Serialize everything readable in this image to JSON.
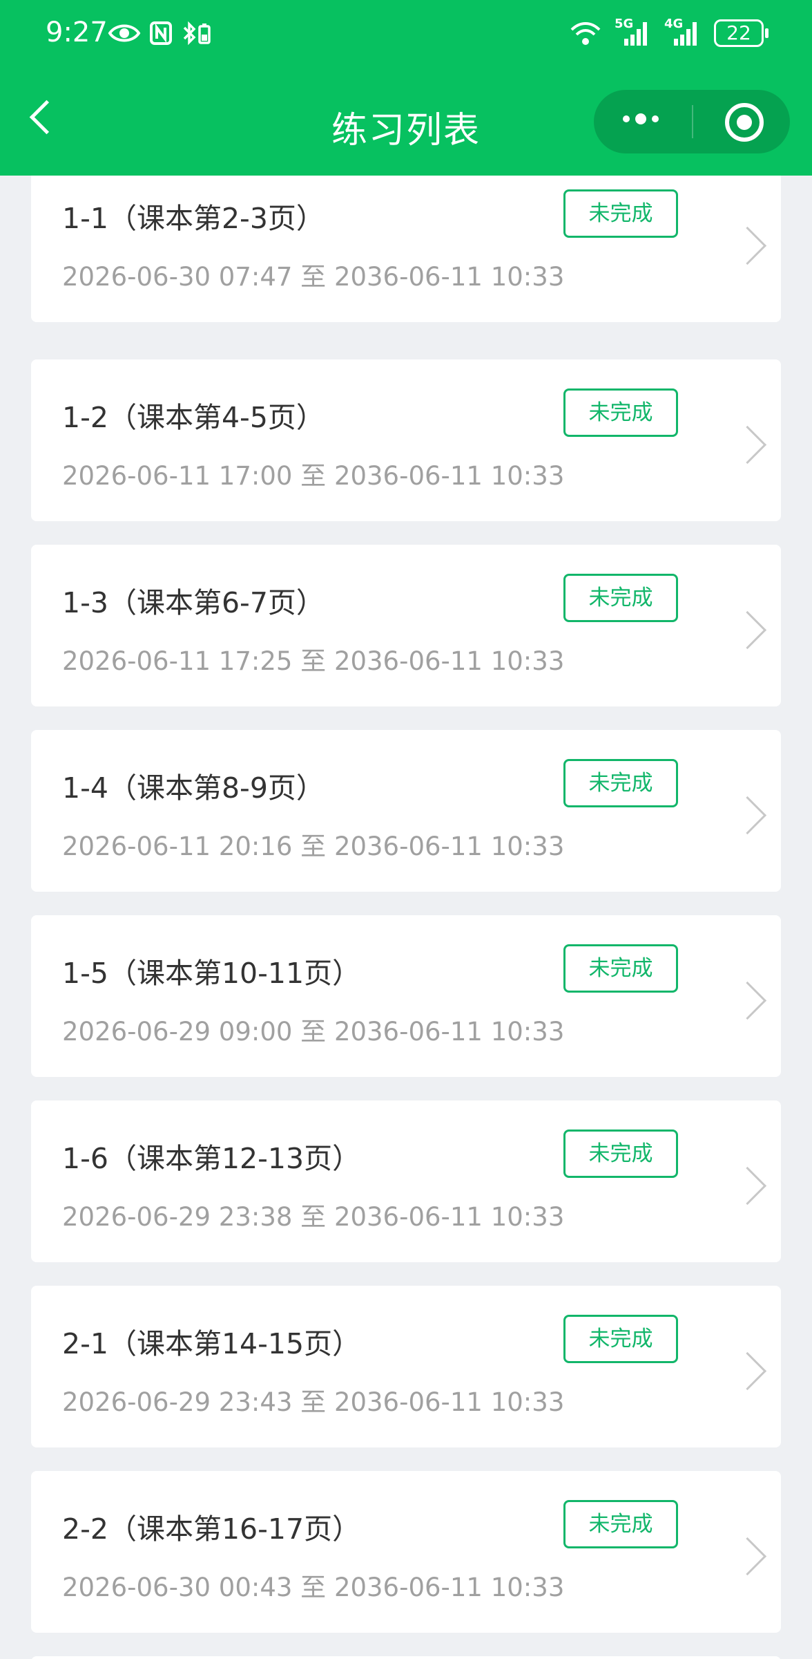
{
  "status_bar": {
    "time": "9:27",
    "icons_left": [
      "eye-icon",
      "nfc-icon",
      "bluetooth-battery-icon"
    ],
    "icons_right": [
      "wifi-icon",
      "signal-5g-icon",
      "signal-4g-icon"
    ],
    "network_5g": "5G",
    "network_4g": "4G",
    "battery": "22"
  },
  "navbar": {
    "title": "练习列表",
    "back_icon": "chevron-left-icon",
    "more_icon": "more-dots-icon",
    "close_icon": "target-icon"
  },
  "colors": {
    "brand": "#07c160",
    "badge": "#12b66a",
    "background": "#eef0f3"
  },
  "items": [
    {
      "title": "1-1（课本第2-3页）",
      "time": "2026-06-30 07:47 至 2036-06-11 10:33",
      "status": "未完成"
    },
    {
      "title": "1-2（课本第4-5页）",
      "time": "2026-06-11 17:00 至 2036-06-11 10:33",
      "status": "未完成"
    },
    {
      "title": "1-3（课本第6-7页）",
      "time": "2026-06-11 17:25 至 2036-06-11 10:33",
      "status": "未完成"
    },
    {
      "title": "1-4（课本第8-9页）",
      "time": "2026-06-11 20:16 至 2036-06-11 10:33",
      "status": "未完成"
    },
    {
      "title": "1-5（课本第10-11页）",
      "time": "2026-06-29 09:00 至 2036-06-11 10:33",
      "status": "未完成"
    },
    {
      "title": "1-6（课本第12-13页）",
      "time": "2026-06-29 23:38 至 2036-06-11 10:33",
      "status": "未完成"
    },
    {
      "title": "2-1（课本第14-15页）",
      "time": "2026-06-29 23:43 至 2036-06-11 10:33",
      "status": "未完成"
    },
    {
      "title": "2-2（课本第16-17页）",
      "time": "2026-06-30 00:43 至 2036-06-11 10:33",
      "status": "未完成"
    }
  ]
}
